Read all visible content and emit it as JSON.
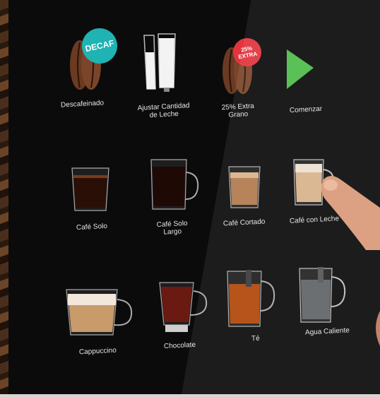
{
  "colors": {
    "decaf_badge": "#1fb3b3",
    "extra_badge": "#e2343c",
    "play": "#4dbb4a",
    "panel": "#0b0b0c"
  },
  "top_row": {
    "decaf": {
      "label": "Descafeinado",
      "badge": "DECAF",
      "icon": "coffee-bean-icon"
    },
    "milk": {
      "label_line1": "Ajustar Cantidad",
      "label_line2": "de Leche",
      "icon": "milk-glass-icon"
    },
    "extra": {
      "label_line1": "25% Extra",
      "label_line2": "Grano",
      "badge_line1": "25%",
      "badge_line2": "EXTRA",
      "icon": "coffee-bean-icon"
    },
    "start": {
      "label": "Comenzar",
      "icon": "play-icon"
    }
  },
  "drinks": [
    {
      "label": "Café Solo"
    },
    {
      "label_line1": "Café Solo",
      "label_line2": "Largo"
    },
    {
      "label": "Café Cortado"
    },
    {
      "label": "Café con Leche"
    },
    {
      "label": "Cappuccino"
    },
    {
      "label": "Chocolate"
    },
    {
      "label": "Té"
    },
    {
      "label": "Agua Caliente"
    }
  ]
}
